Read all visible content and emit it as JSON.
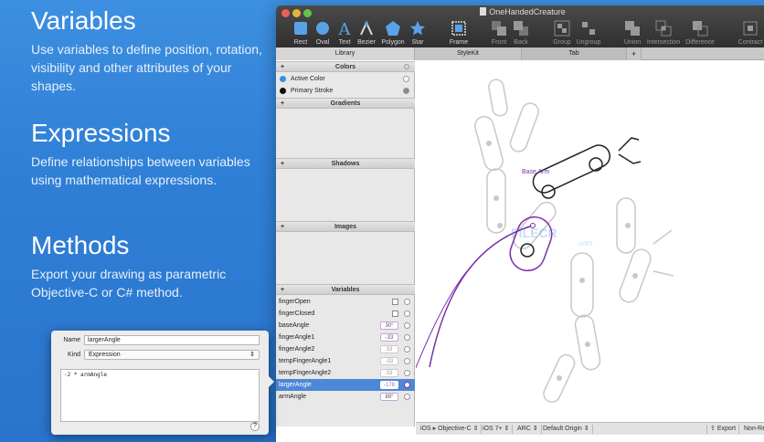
{
  "promo": [
    {
      "title": "Variables",
      "body": "Use variables to define position, rotation, visibility and other attributes of your shapes."
    },
    {
      "title": "Expressions",
      "body": "Define relationships between variables using mathematical expressions."
    },
    {
      "title": "Methods",
      "body": "Export your drawing as parametric Objective-C or C# method."
    }
  ],
  "window": {
    "title": "OneHandedCreature",
    "toolbar": [
      {
        "label": "Rect",
        "icon": "rect-icon"
      },
      {
        "label": "Oval",
        "icon": "oval-icon"
      },
      {
        "label": "Text",
        "icon": "text-icon"
      },
      {
        "label": "Bezier",
        "icon": "bezier-icon"
      },
      {
        "label": "Polygon",
        "icon": "polygon-icon"
      },
      {
        "label": "Star",
        "icon": "star-icon"
      },
      {
        "label": "Frame",
        "icon": "frame-icon"
      },
      {
        "label": "Front",
        "icon": "front-icon"
      },
      {
        "label": "Back",
        "icon": "back-icon"
      },
      {
        "label": "Group",
        "icon": "group-icon"
      },
      {
        "label": "Ungroup",
        "icon": "ungroup-icon"
      },
      {
        "label": "Union",
        "icon": "union-icon"
      },
      {
        "label": "Intersection",
        "icon": "intersection-icon"
      },
      {
        "label": "Difference",
        "icon": "difference-icon"
      },
      {
        "label": "Contract",
        "icon": "contract-icon"
      }
    ],
    "tabs": {
      "library": "Library",
      "stylekit": "StyleKit",
      "tab": "Tab",
      "add": "+"
    }
  },
  "library": {
    "colors_header": "Colors",
    "colors": [
      {
        "name": "Active Color",
        "color": "#3b8fe6"
      },
      {
        "name": "Primary Stroke",
        "color": "#111111"
      }
    ],
    "gradients_header": "Gradients",
    "shadows_header": "Shadows",
    "images_header": "Images",
    "variables_header": "Variables",
    "variables": [
      {
        "name": "fingerOpen",
        "kind": "bool"
      },
      {
        "name": "fingerClosed",
        "kind": "bool"
      },
      {
        "name": "baseAngle",
        "value": "30°"
      },
      {
        "name": "fingerAngle1",
        "value": "-33"
      },
      {
        "name": "fingerAngle2",
        "value": "33"
      },
      {
        "name": "tempFingerAngle1",
        "value": "-33"
      },
      {
        "name": "tempFingerAngle2",
        "value": "33"
      },
      {
        "name": "largerAngle",
        "value": "-178"
      },
      {
        "name": "armAngle",
        "value": "89°"
      }
    ]
  },
  "canvas": {
    "base_arm_label": "Base Arm",
    "watermark": "FILECR",
    "watermark_sub": ".com"
  },
  "bottombar": {
    "platform": "iOS ▸ Objective-C ⇕",
    "version": "iOS 7+ ⇕",
    "arc": "ARC ⇕",
    "origin": "Default Origin ⇕",
    "export": "Export",
    "nonretina": "Non-Re"
  },
  "inspector": {
    "name_label": "Name",
    "name_value": "largerAngle",
    "kind_label": "Kind",
    "kind_value": "Expression",
    "expression": "-2 * armAngle",
    "help": "?"
  },
  "colors": {
    "accent": "#7b2fa8",
    "selection": "#4d88d6"
  }
}
